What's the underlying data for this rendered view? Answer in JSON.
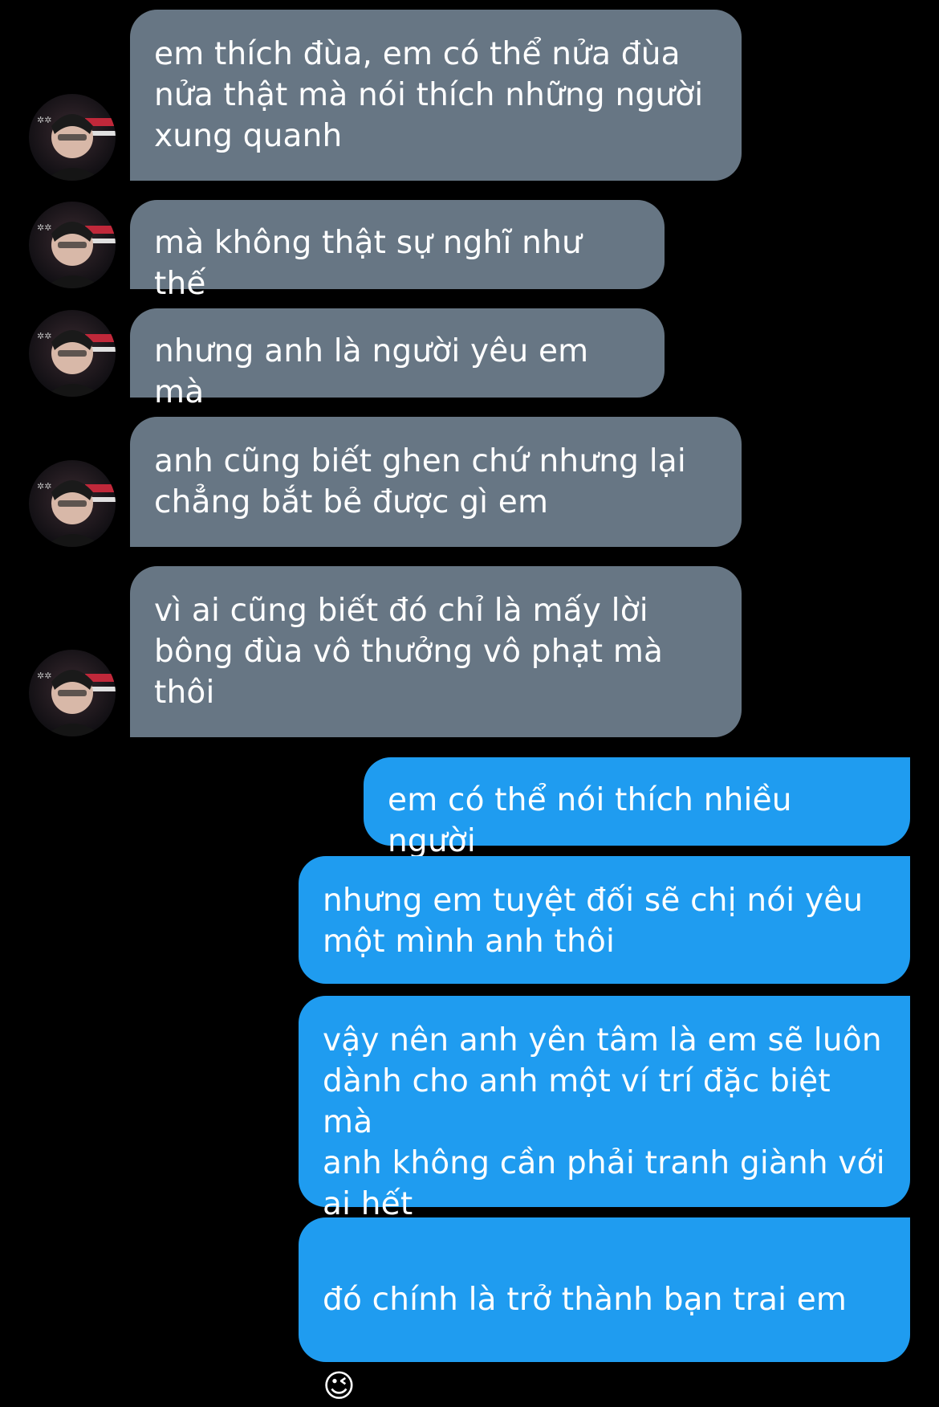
{
  "incoming": [
    {
      "text": "em thích đùa, em có thể nửa đùa\nnửa thật mà nói thích những người\nxung quanh"
    },
    {
      "text": "mà không thật sự nghĩ như thế"
    },
    {
      "text": "nhưng anh là người yêu em mà"
    },
    {
      "text": "anh cũng biết ghen chứ nhưng lại\nchẳng bắt bẻ được gì em"
    },
    {
      "text": "vì ai cũng biết đó chỉ là mấy lời\nbông đùa vô thưởng vô phạt mà\nthôi"
    }
  ],
  "outgoing": [
    {
      "text": "em có thể nói thích nhiều người"
    },
    {
      "text": "nhưng em tuyệt đối sẽ chị nói yêu\nmột mình anh thôi"
    },
    {
      "text": "vậy nên anh yên tâm là em sẽ luôn\ndành cho anh một ví trí đặc biệt mà\nanh không cần phải tranh giành với\nai hết"
    },
    {
      "text": "đó chính là trở thành bạn trai em",
      "emoji": "😉"
    }
  ],
  "colors": {
    "background": "#000000",
    "incoming_bubble": "#677684",
    "outgoing_bubble": "#1f9cf0",
    "text": "#ffffff"
  },
  "icons": {
    "avatar": "contact-avatar-photo"
  }
}
